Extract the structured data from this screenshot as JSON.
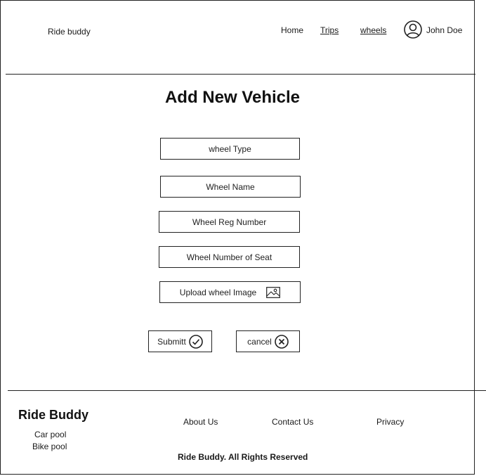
{
  "header": {
    "brand": "Ride buddy",
    "nav": {
      "home": "Home",
      "trips": "Trips",
      "wheels": "wheels"
    },
    "user": {
      "name": "John Doe",
      "icon": "user-avatar-icon"
    }
  },
  "page": {
    "title": "Add New Vehicle"
  },
  "form": {
    "wheel_type": "wheel Type",
    "wheel_name": "Wheel Name",
    "wheel_reg_number": "Wheel Reg Number",
    "wheel_seats": "Wheel Number of Seat",
    "upload_image": {
      "label": "Upload wheel Image",
      "icon": "image-icon"
    },
    "submit": {
      "label": "Submitt",
      "icon": "check-circle-icon"
    },
    "cancel": {
      "label": "cancel",
      "icon": "close-circle-icon"
    }
  },
  "footer": {
    "brand": "Ride Buddy",
    "services": [
      "Car pool",
      "Bike pool"
    ],
    "links": {
      "about": "About Us",
      "contact": "Contact Us",
      "privacy": "Privacy"
    },
    "copyright": "Ride Buddy. All Rights Reserved"
  }
}
